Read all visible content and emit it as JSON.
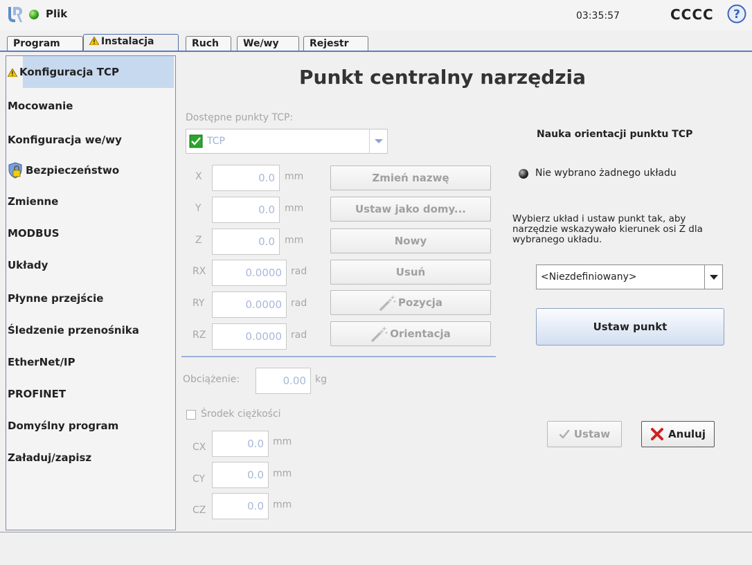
{
  "header": {
    "file_label": "Plik",
    "clock": "03:35:57",
    "robot_name": "CCCC"
  },
  "tabs": [
    {
      "label": "Program"
    },
    {
      "label": "Instalacja"
    },
    {
      "label": "Ruch"
    },
    {
      "label": "We/wy"
    },
    {
      "label": "Rejestr"
    }
  ],
  "sidebar": {
    "items": [
      {
        "label": "Konfiguracja TCP"
      },
      {
        "label": "Mocowanie"
      },
      {
        "label": "Konfiguracja we/wy"
      },
      {
        "label": "Bezpieczeństwo"
      },
      {
        "label": "Zmienne"
      },
      {
        "label": "MODBUS"
      },
      {
        "label": "Układy"
      },
      {
        "label": "Płynne przejście"
      },
      {
        "label": "Śledzenie przenośnika"
      },
      {
        "label": "EtherNet/IP"
      },
      {
        "label": "PROFINET"
      },
      {
        "label": "Domyślny program"
      },
      {
        "label": "Załaduj/zapisz"
      }
    ]
  },
  "main": {
    "title": "Punkt centralny narzędzia",
    "tcp_label": "Dostępne punkty TCP:",
    "tcp_selected": "TCP",
    "coords": [
      {
        "label": "X",
        "value": "0.0",
        "unit": "mm"
      },
      {
        "label": "Y",
        "value": "0.0",
        "unit": "mm"
      },
      {
        "label": "Z",
        "value": "0.0",
        "unit": "mm"
      },
      {
        "label": "RX",
        "value": "0.0000",
        "unit": "rad"
      },
      {
        "label": "RY",
        "value": "0.0000",
        "unit": "rad"
      },
      {
        "label": "RZ",
        "value": "0.0000",
        "unit": "rad"
      }
    ],
    "buttons": {
      "rename": "Zmień nazwę",
      "set_default": "Ustaw jako domy...",
      "new": "Nowy",
      "delete": "Usuń",
      "position": "Pozycja",
      "orientation": "Orientacja"
    },
    "payload_label": "Obciążenie:",
    "payload_value": "0.00",
    "payload_unit": "kg",
    "cog_label": "Środek ciężkości",
    "cog": [
      {
        "label": "CX",
        "value": "0.0",
        "unit": "mm"
      },
      {
        "label": "CY",
        "value": "0.0",
        "unit": "mm"
      },
      {
        "label": "CZ",
        "value": "0.0",
        "unit": "mm"
      }
    ]
  },
  "right_panel": {
    "title": "Nauka orientacji punktu TCP",
    "radio_label": "Nie wybrano żadnego układu",
    "description": "Wybierz układ i ustaw punkt tak, aby narzędzie wskazywało kierunek osi Z dla wybranego układu.",
    "frame_select": "<Niezdefiniowany>",
    "set_point": "Ustaw punkt",
    "ok": "Ustaw",
    "cancel": "Anuluj"
  }
}
